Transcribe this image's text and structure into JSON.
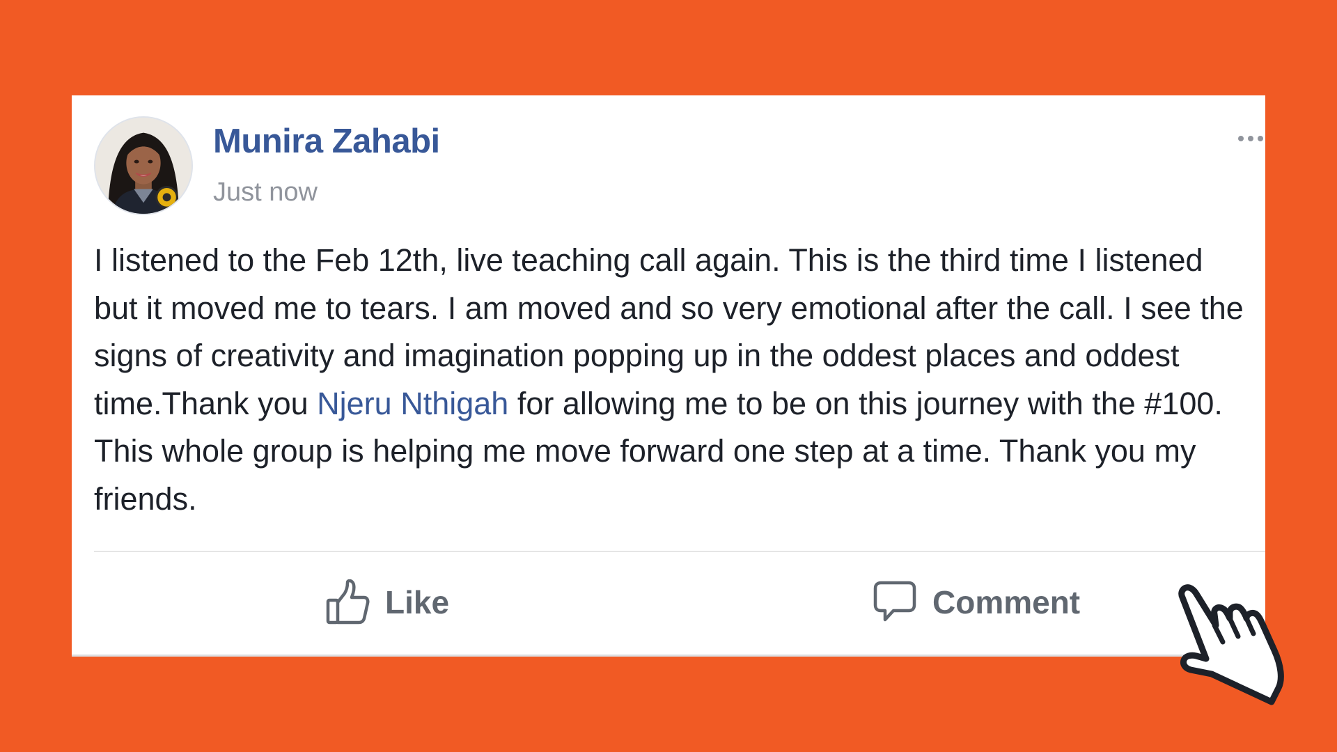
{
  "post": {
    "author": "Munira Zahabi",
    "timestamp": "Just now",
    "body": {
      "before_mention": "I listened to the Feb 12th, live teaching call again. This is the third time I listened but it moved me to tears. I am moved and so very emotional after the call. I see the signs of creativity and imagination popping up in the oddest places and oddest time.Thank you ",
      "mention": "Njeru Nthigah",
      "after_mention": " for allowing me to be on this journey with the #100. This whole group is helping me move forward one step at a time. Thank you my friends."
    }
  },
  "actions": {
    "like_label": "Like",
    "comment_label": "Comment"
  },
  "icons": {
    "avatar": "profile-photo",
    "menu": "more-options-icon",
    "like": "thumbs-up-icon",
    "comment": "speech-bubble-icon",
    "cursor": "pointer-hand-icon"
  },
  "colors": {
    "background": "#f15a24",
    "card": "#ffffff",
    "author_link": "#385898",
    "timestamp": "#90949c",
    "body_text": "#1d2129",
    "action_text": "#606770"
  }
}
